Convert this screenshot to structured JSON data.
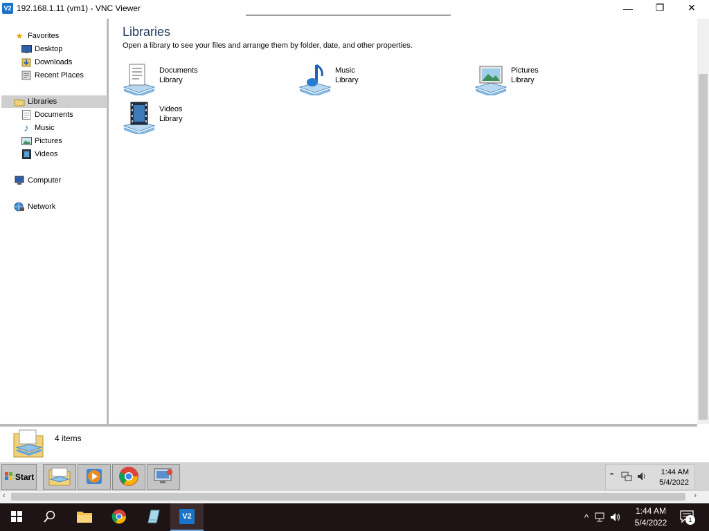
{
  "window": {
    "title": "192.168.1.11 (vm1) - VNC Viewer",
    "logo_text": "V2",
    "minimize": "—",
    "maximize": "❐",
    "close": "✕"
  },
  "nav": {
    "favorites": {
      "label": "Favorites",
      "icon": "star-icon"
    },
    "favorites_items": [
      {
        "label": "Desktop",
        "icon": "desktop-icon"
      },
      {
        "label": "Downloads",
        "icon": "downloads-icon"
      },
      {
        "label": "Recent Places",
        "icon": "recent-places-icon"
      }
    ],
    "libraries": {
      "label": "Libraries",
      "icon": "libraries-icon",
      "selected": true
    },
    "libraries_items": [
      {
        "label": "Documents",
        "icon": "documents-icon"
      },
      {
        "label": "Music",
        "icon": "music-icon"
      },
      {
        "label": "Pictures",
        "icon": "pictures-icon"
      },
      {
        "label": "Videos",
        "icon": "videos-icon"
      }
    ],
    "computer": {
      "label": "Computer",
      "icon": "computer-icon"
    },
    "network": {
      "label": "Network",
      "icon": "network-icon"
    }
  },
  "content": {
    "title": "Libraries",
    "subtitle": "Open a library to see your files and arrange them by folder, date, and other properties.",
    "libraries": [
      {
        "name": "Documents",
        "type": "Library",
        "icon": "documents-library-icon"
      },
      {
        "name": "Music",
        "type": "Library",
        "icon": "music-library-icon"
      },
      {
        "name": "Pictures",
        "type": "Library",
        "icon": "pictures-library-icon"
      },
      {
        "name": "Videos",
        "type": "Library",
        "icon": "videos-library-icon"
      }
    ]
  },
  "status": {
    "count": "4 items"
  },
  "remote_taskbar": {
    "start_label": "Start",
    "time": "1:44 AM",
    "date": "5/4/2022",
    "tray_up": "≈"
  },
  "host_taskbar": {
    "time": "1:44 AM",
    "date": "5/4/2022",
    "notification_count": "1",
    "tray_up": "^"
  },
  "colors": {
    "title_blue": "#1e3a5a",
    "selection_gray": "#cfcfcf",
    "host_taskbar": "#1f1415",
    "vnc_blue": "#1a73c7"
  }
}
